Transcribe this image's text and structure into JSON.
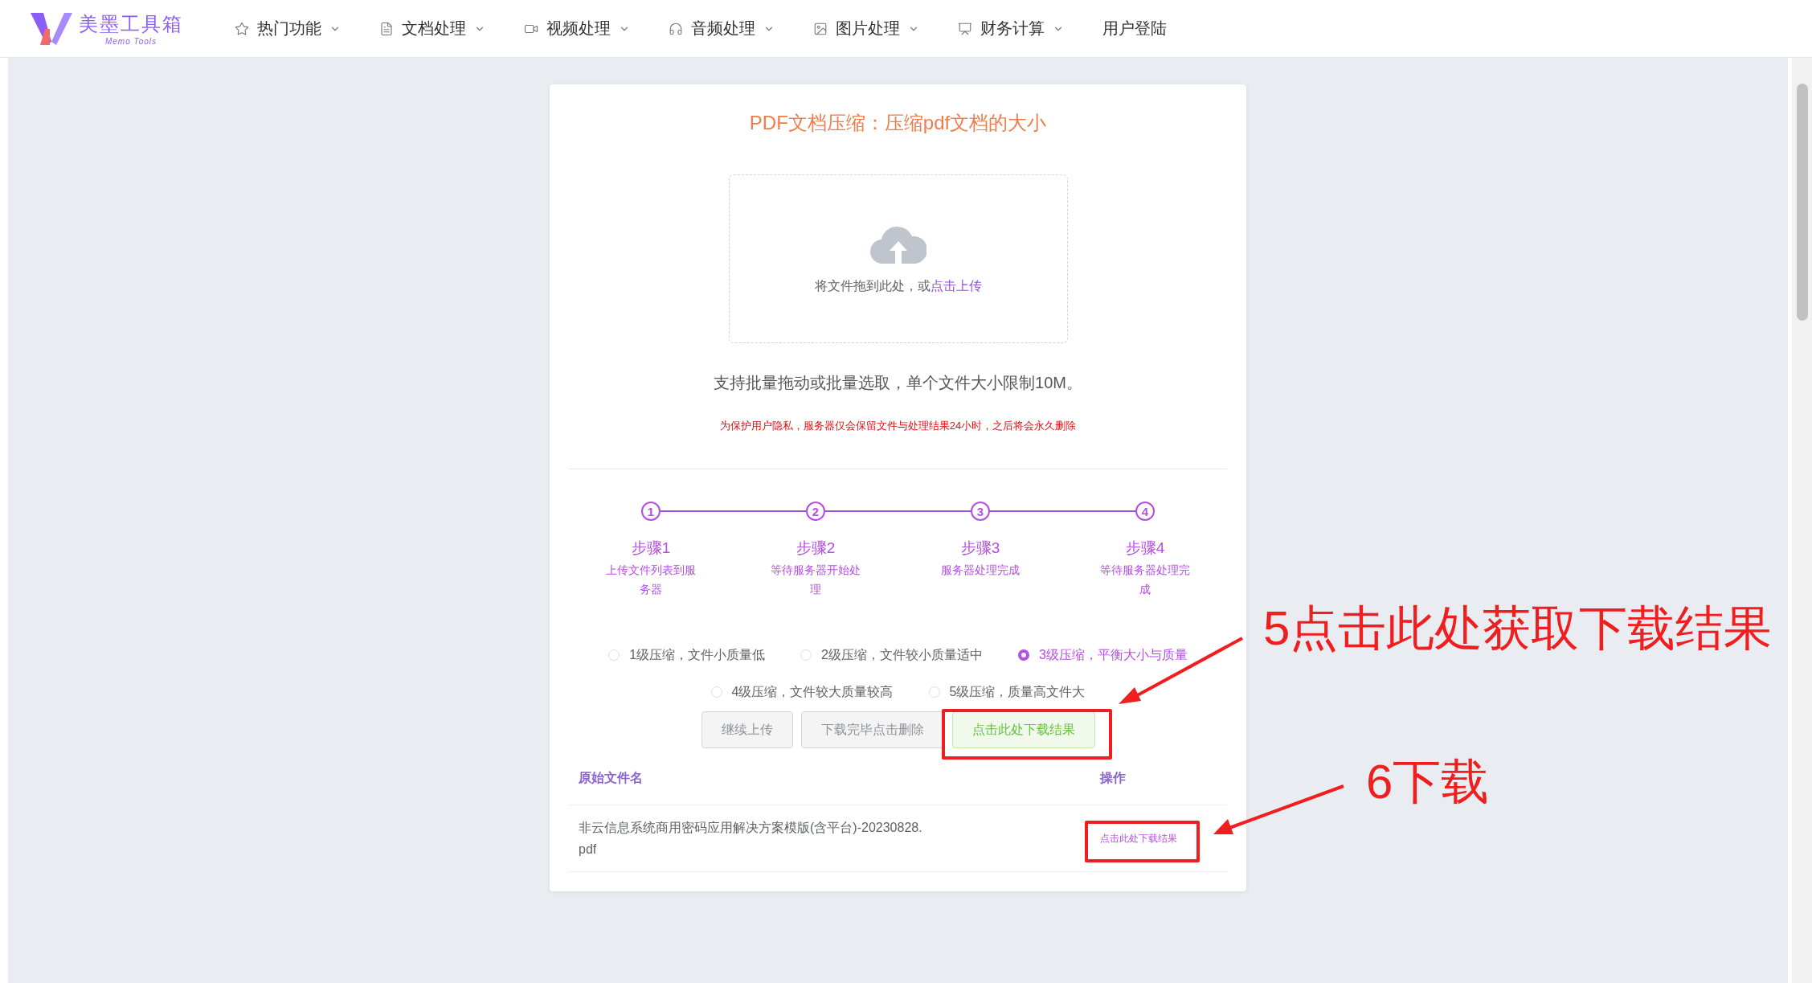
{
  "logo": {
    "name": "美墨工具箱",
    "tagline": "Memo Tools"
  },
  "nav": [
    {
      "label": "热门功能",
      "dropdown": true
    },
    {
      "label": "文档处理",
      "dropdown": true
    },
    {
      "label": "视频处理",
      "dropdown": true
    },
    {
      "label": "音频处理",
      "dropdown": true
    },
    {
      "label": "图片处理",
      "dropdown": true
    },
    {
      "label": "财务计算",
      "dropdown": true
    },
    {
      "label": "用户登陆",
      "dropdown": false
    }
  ],
  "title": "PDF文档压缩：压缩pdf文档的大小",
  "upload": {
    "text": "将文件拖到此处，或",
    "link": "点击上传"
  },
  "note": "支持批量拖动或批量选取，单个文件大小限制10M。",
  "privacy": "为保护用户隐私，服务器仅会保留文件与处理结果24小时，之后将会永久删除",
  "steps": [
    {
      "number": "1",
      "title": "步骤1",
      "description": "上传文件列表到服务器"
    },
    {
      "number": "2",
      "title": "步骤2",
      "description": "等待服务器开始处理"
    },
    {
      "number": "3",
      "title": "步骤3",
      "description": "服务器处理完成"
    },
    {
      "number": "4",
      "title": "步骤4",
      "description": "等待服务器处理完成"
    }
  ],
  "compression_levels": [
    [
      {
        "label": "1级压缩，文件小质量低",
        "selected": false
      },
      {
        "label": "2级压缩，文件较小质量适中",
        "selected": false
      },
      {
        "label": "3级压缩，平衡大小与质量",
        "selected": true
      }
    ],
    [
      {
        "label": "4级压缩，文件较大质量较高",
        "selected": false
      },
      {
        "label": "5级压缩，质量高文件大",
        "selected": false
      }
    ]
  ],
  "buttons": [
    {
      "label": "继续上传",
      "kind": "plain"
    },
    {
      "label": "下载完毕点击删除",
      "kind": "plain"
    },
    {
      "label": "点击此处下载结果",
      "kind": "success"
    }
  ],
  "table": {
    "columns": [
      "原始文件名",
      "操作"
    ],
    "rows": [
      {
        "filename": "非云信息系统商用密码应用解决方案模版(含平台)-20230828.\npdf",
        "action": "点击此处下载结果"
      }
    ]
  },
  "annotations": [
    {
      "text": "5点击此处获取下载结果"
    },
    {
      "text": "6下载"
    }
  ]
}
